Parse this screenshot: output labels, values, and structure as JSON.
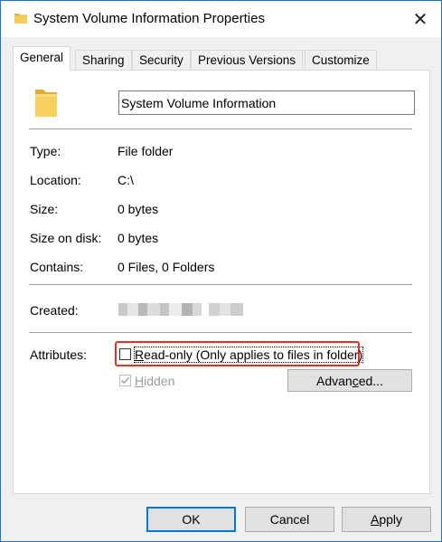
{
  "window": {
    "title": "System Volume Information Properties",
    "close_glyph": "✕"
  },
  "tabs": [
    {
      "label": "General",
      "active": true
    },
    {
      "label": "Sharing",
      "active": false
    },
    {
      "label": "Security",
      "active": false
    },
    {
      "label": "Previous Versions",
      "active": false
    },
    {
      "label": "Customize",
      "active": false
    }
  ],
  "general": {
    "name_value": "System Volume Information",
    "fields": [
      {
        "label": "Type:",
        "value": "File folder"
      },
      {
        "label": "Location:",
        "value": "C:\\"
      },
      {
        "label": "Size:",
        "value": "0 bytes"
      },
      {
        "label": "Size on disk:",
        "value": "0 bytes"
      },
      {
        "label": "Contains:",
        "value": "0 Files, 0 Folders"
      }
    ],
    "created_label": "Created:",
    "attributes_label": "Attributes:",
    "readonly_label": "Read-only (Only applies to files in folder)",
    "readonly_first": "R",
    "readonly_rest": "ead-only (Only applies to files in folder)",
    "hidden_label": "Hidden",
    "hidden_first": "H",
    "hidden_rest": "idden",
    "advanced_first": "Advan",
    "advanced_u": "c",
    "advanced_rest": "ed..."
  },
  "footer": {
    "ok_label": "OK",
    "cancel_label": "Cancel",
    "apply_first": "A",
    "apply_rest": "pply"
  },
  "colors": {
    "accent": "#0078d7",
    "highlight_border": "#e0312c",
    "folder": "#f0c24e"
  },
  "icons": [
    "folder-icon",
    "close-icon",
    "checkmark-icon"
  ]
}
